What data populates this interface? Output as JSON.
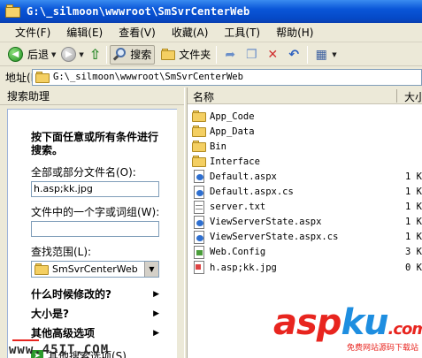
{
  "window": {
    "title": "G:\\_silmoon\\wwwroot\\SmSvrCenterWeb"
  },
  "menu": [
    "文件(F)",
    "编辑(E)",
    "查看(V)",
    "收藏(A)",
    "工具(T)",
    "帮助(H)"
  ],
  "toolbar": {
    "back_label": "后退",
    "search_label": "搜索",
    "folders_label": "文件夹"
  },
  "address": {
    "label": "地址(D)",
    "path": "G:\\_silmoon\\wwwroot\\SmSvrCenterWeb"
  },
  "search_pane": {
    "title": "搜索助理",
    "prompt": "按下面任意或所有条件进行搜索。",
    "name_label": "全部或部分文件名(O):",
    "name_value": "h.asp;kk.jpg",
    "content_label": "文件中的一个字或词组(W):",
    "content_value": "",
    "scope_label": "查找范围(L):",
    "scope_value": "SmSvrCenterWeb",
    "expanders": [
      "什么时候修改的?",
      "大小是?",
      "其他高级选项"
    ],
    "other_options": "其他搜索选项(S)"
  },
  "file_list": {
    "columns": {
      "name": "名称",
      "size": "大小"
    },
    "rows": [
      {
        "name": "App_Code",
        "type": "folder",
        "size": ""
      },
      {
        "name": "App_Data",
        "type": "folder",
        "size": ""
      },
      {
        "name": "Bin",
        "type": "folder",
        "size": ""
      },
      {
        "name": "Interface",
        "type": "folder",
        "size": ""
      },
      {
        "name": "Default.aspx",
        "type": "aspx",
        "size": "1 K"
      },
      {
        "name": "Default.aspx.cs",
        "type": "aspx",
        "size": "1 K"
      },
      {
        "name": "server.txt",
        "type": "txt",
        "size": "1 K"
      },
      {
        "name": "ViewServerState.aspx",
        "type": "aspx",
        "size": "1 K"
      },
      {
        "name": "ViewServerState.aspx.cs",
        "type": "aspx",
        "size": "1 K"
      },
      {
        "name": "Web.Config",
        "type": "cfg",
        "size": "3 K"
      },
      {
        "name": "h.asp;kk.jpg",
        "type": "jpg",
        "size": "0 K"
      }
    ]
  },
  "watermark": {
    "brand_a": "asp",
    "brand_b": "ku",
    "brand_c": ".com",
    "sub": "免费网站源码下载站",
    "site": "www.45IT.COM"
  }
}
